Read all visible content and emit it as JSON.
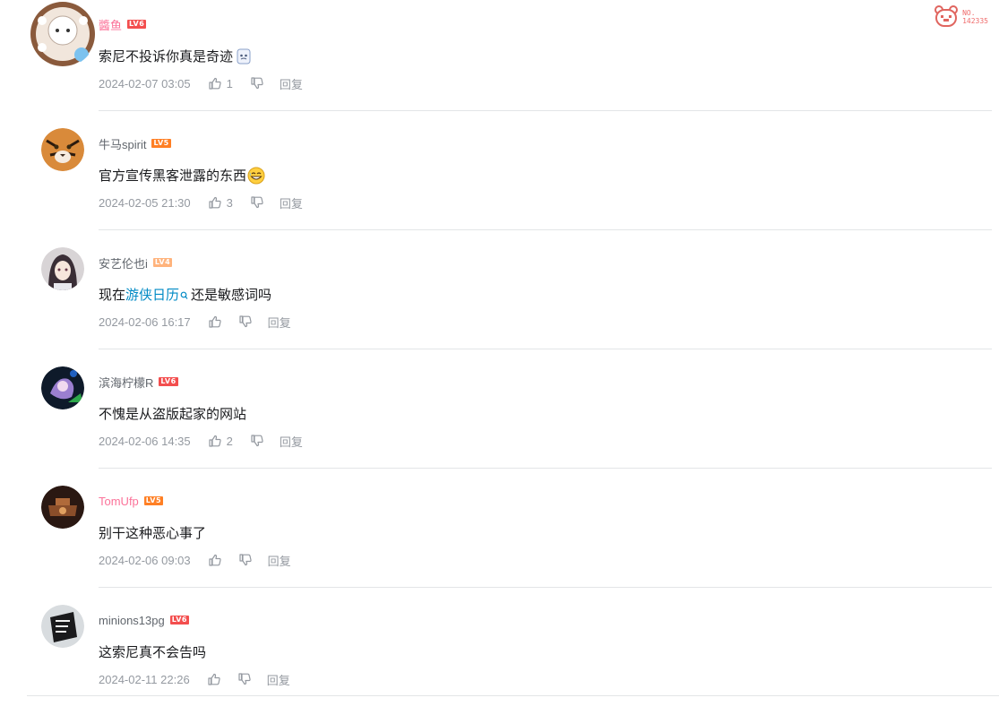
{
  "fan_badge": {
    "no_label": "NO.",
    "number": "142335",
    "color": "#f06a6a"
  },
  "comments": [
    {
      "username": "醬鱼",
      "level": "LV6",
      "level_color": "#f34e4e",
      "text": "索尼不投诉你真是奇迹",
      "emoji": "fridge",
      "time": "2024-02-07 03:05",
      "likes": "1",
      "reply_label": "回复",
      "name_color": "#fb7299"
    },
    {
      "username": "牛马spirit",
      "level": "LV5",
      "level_color": "#ff7f24",
      "text": "官方宣传黑客泄露的东西",
      "emoji": "grin",
      "time": "2024-02-05 21:30",
      "likes": "3",
      "reply_label": "回复",
      "name_color": "#61666d"
    },
    {
      "username": "安艺伦也i",
      "level": "LV4",
      "level_color": "#ffb37c",
      "text_before": "现在",
      "text_link": "游侠日历",
      "text_after": "还是敏感词吗",
      "time": "2024-02-06 16:17",
      "likes": "",
      "reply_label": "回复",
      "name_color": "#61666d"
    },
    {
      "username": "滨海柠檬R",
      "level": "LV6",
      "level_color": "#f34e4e",
      "text": "不愧是从盗版起家的网站",
      "time": "2024-02-06 14:35",
      "likes": "2",
      "reply_label": "回复",
      "name_color": "#61666d"
    },
    {
      "username": "TomUfp",
      "level": "LV5",
      "level_color": "#ff7f24",
      "text": "别干这种恶心事了",
      "time": "2024-02-06 09:03",
      "likes": "",
      "reply_label": "回复",
      "name_color": "#fb7299"
    },
    {
      "username": "minions13pg",
      "level": "LV6",
      "level_color": "#f34e4e",
      "text": "这索尼真不会告吗",
      "time": "2024-02-11 22:26",
      "likes": "",
      "reply_label": "回复",
      "name_color": "#61666d"
    }
  ]
}
